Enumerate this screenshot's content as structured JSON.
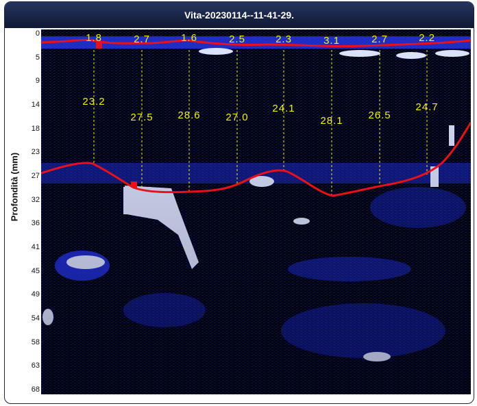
{
  "window": {
    "title": "Vita-20230114--11-41-29."
  },
  "axis": {
    "ylabel": "Profondità (mm)",
    "yticks": [
      "0",
      "5",
      "9",
      "14",
      "18",
      "23",
      "27",
      "32",
      "36",
      "41",
      "45",
      "49",
      "54",
      "58",
      "63",
      "68"
    ]
  },
  "measurements": [
    {
      "top": "1.8",
      "thickness": "23.2"
    },
    {
      "top": "2.7",
      "thickness": "27.5"
    },
    {
      "top": "1.6",
      "thickness": "28.6"
    },
    {
      "top": "2.5",
      "thickness": "27.0"
    },
    {
      "top": "2.3",
      "thickness": "24.1"
    },
    {
      "top": "3.1",
      "thickness": "28.1"
    },
    {
      "top": "2.7",
      "thickness": "26.5"
    },
    {
      "top": "2.2",
      "thickness": "24.7"
    }
  ],
  "colors": {
    "boundary": "#e8101a",
    "marker_text": "#f4f400",
    "guide": "#f4f400",
    "background": "#000010",
    "echo": "#2a3cff"
  }
}
